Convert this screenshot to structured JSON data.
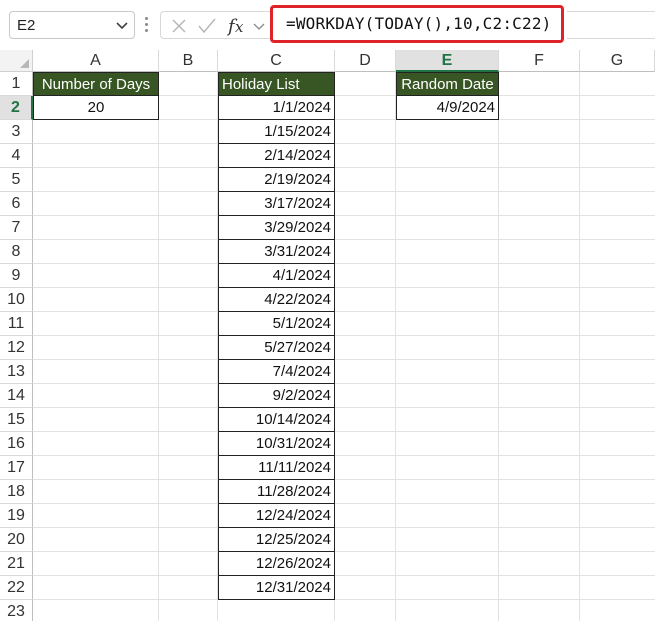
{
  "formula_bar": {
    "name_box": "E2",
    "formula": "=WORKDAY(TODAY(),10,C2:C22)",
    "icons": [
      "chevron-down-icon",
      "cancel-icon",
      "confirm-icon",
      "function-icon"
    ]
  },
  "columns": [
    "A",
    "B",
    "C",
    "D",
    "E",
    "F",
    "G"
  ],
  "active_column": "E",
  "rows": [
    "1",
    "2",
    "3",
    "4",
    "5",
    "6",
    "7",
    "8",
    "9",
    "10",
    "11",
    "12",
    "13",
    "14",
    "15",
    "16",
    "17",
    "18",
    "19",
    "20",
    "21",
    "22",
    "23"
  ],
  "active_row": "2",
  "cells": {
    "A1": "Number of Days",
    "A2": "20",
    "C1": "Holiday List",
    "E1": "Random Date",
    "E2": "4/9/2024"
  },
  "holidays": [
    "1/1/2024",
    "1/15/2024",
    "2/14/2024",
    "2/19/2024",
    "3/17/2024",
    "3/29/2024",
    "3/31/2024",
    "4/1/2024",
    "4/22/2024",
    "5/1/2024",
    "5/27/2024",
    "7/4/2024",
    "9/2/2024",
    "10/14/2024",
    "10/31/2024",
    "11/11/2024",
    "11/28/2024",
    "12/24/2024",
    "12/25/2024",
    "12/26/2024",
    "12/31/2024"
  ],
  "colors": {
    "header_fill": "#375623",
    "header_text": "#ffffff",
    "formula_highlight": "#e0232b",
    "active_accent": "#217346"
  }
}
